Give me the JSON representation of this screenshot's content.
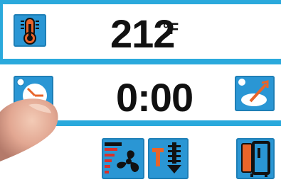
{
  "temperature": {
    "value": "212",
    "unit": "°F",
    "icon": "thermometer-icon"
  },
  "timer": {
    "value": "0:00",
    "left_icon": "timer-clock-icon",
    "right_icon": "timed-probe-icon"
  },
  "bottom_bar": {
    "fan_button_icon": "fan-speed-icon",
    "temp_step_button_icon": "temperature-step-down-icon",
    "oven_button_icon": "oven-door-icon"
  },
  "colors": {
    "frame_blue": "#2aa9dc",
    "tile_blue": "#2a96d4",
    "accent_orange": "#e8652a",
    "accent_red": "#d9302a"
  }
}
